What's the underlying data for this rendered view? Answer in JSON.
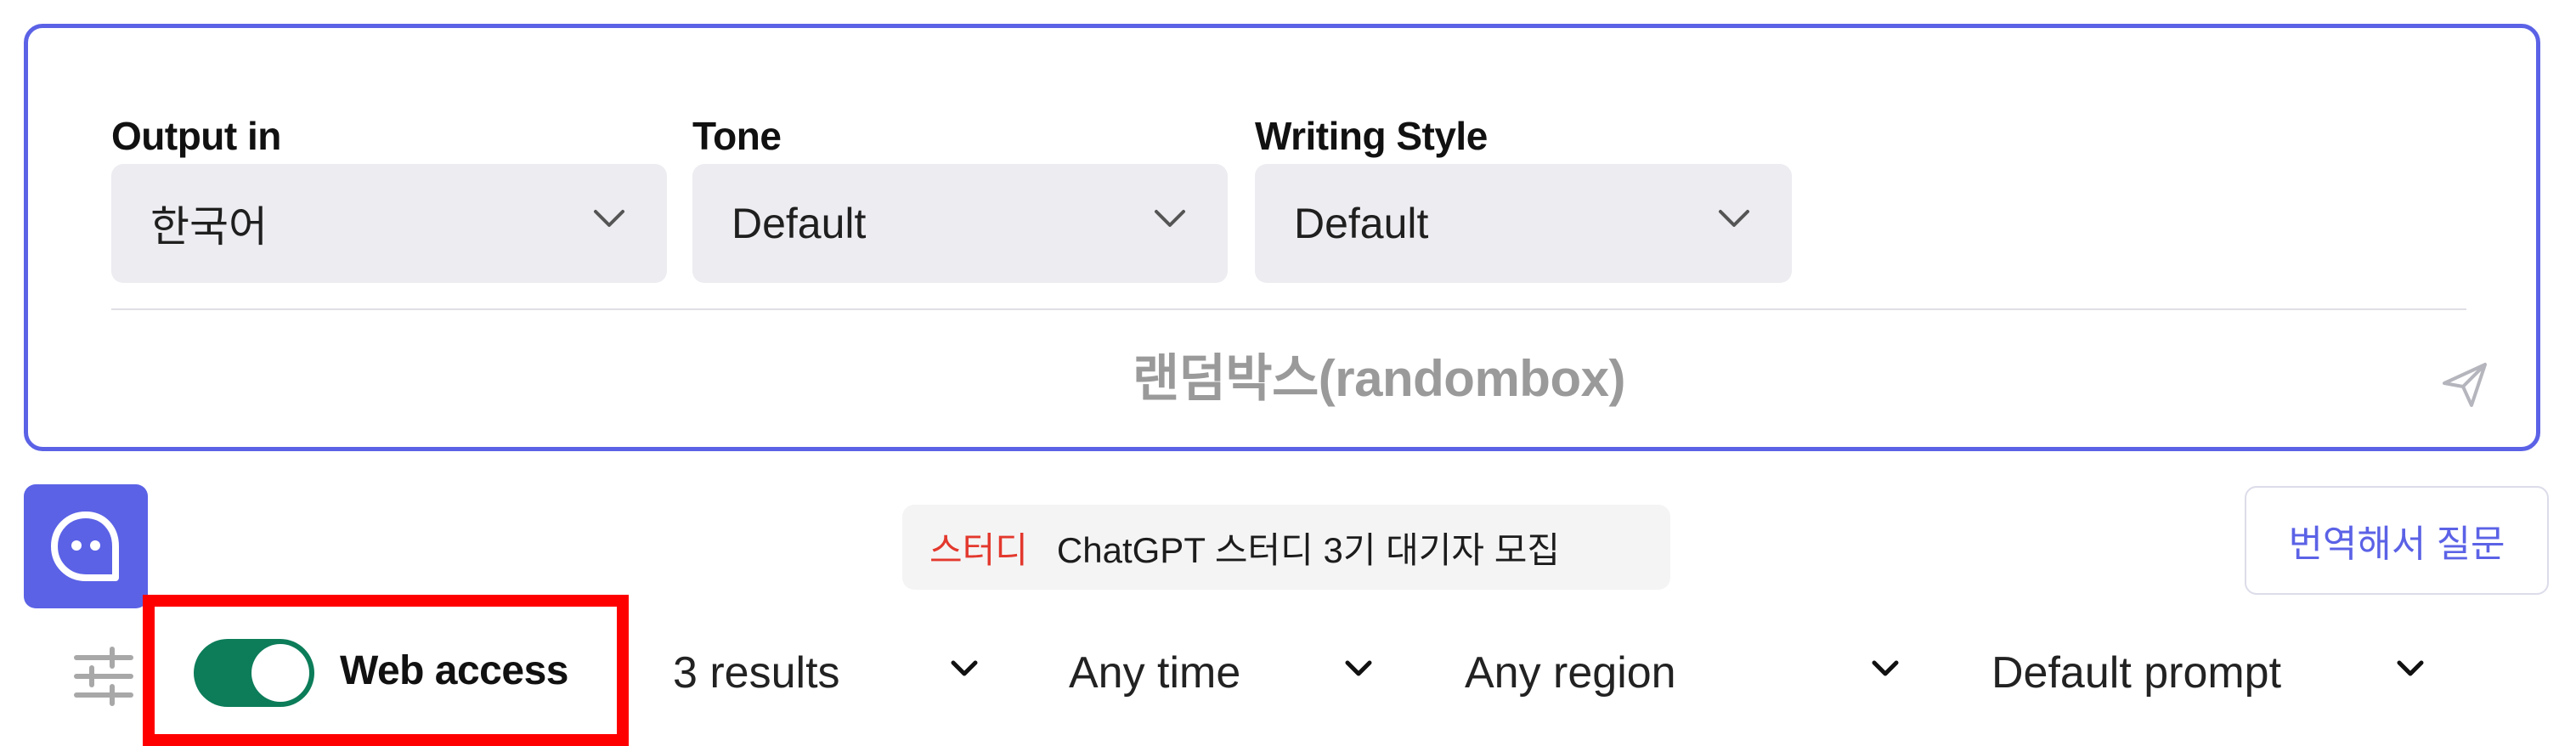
{
  "prompt_card": {
    "output_label": "Output in",
    "output_value": "한국어",
    "tone_label": "Tone",
    "tone_value": "Default",
    "style_label": "Writing Style",
    "style_value": "Default",
    "placeholder": "랜덤박스(randombox)"
  },
  "banner": {
    "tag": "스터디",
    "text": "ChatGPT 스터디 3기 대기자 모집"
  },
  "translate_button": "번역해서 질문",
  "toolbar": {
    "web_access_label": "Web access",
    "web_access_on": true,
    "results": "3 results",
    "time": "Any time",
    "region": "Any region",
    "prompt": "Default prompt"
  },
  "colors": {
    "accent": "#5b62e6",
    "toggle_on": "#0c7c59",
    "highlight": "#ff0000",
    "banner_tag": "#e3382d"
  },
  "icons": [
    "chevron-down-icon",
    "send-icon",
    "chatbot-logo-icon",
    "settings-sliders-icon"
  ]
}
